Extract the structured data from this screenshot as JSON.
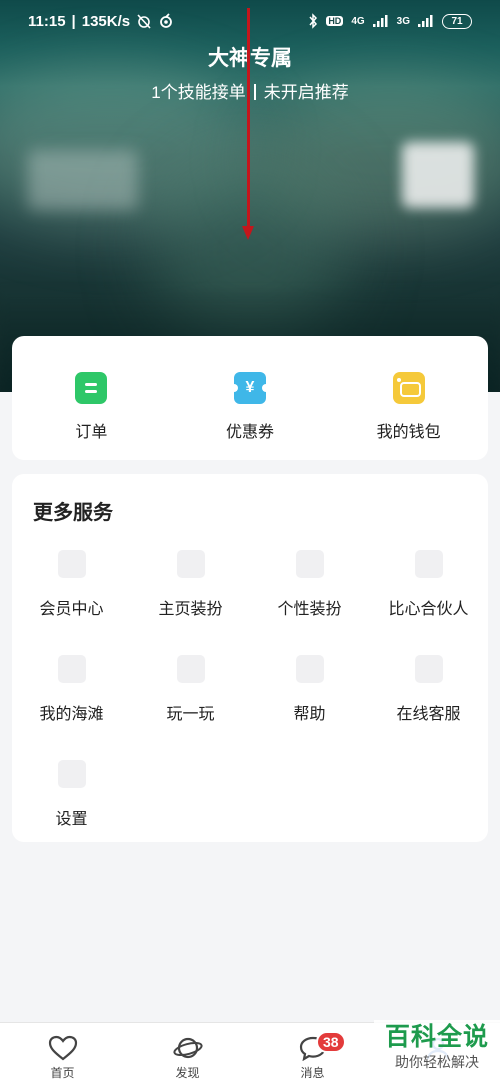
{
  "status_bar": {
    "time": "11:15",
    "speed": "135K/s",
    "signal1": "4G",
    "signal2": "3G",
    "hd": "HD",
    "battery": "71"
  },
  "header": {
    "title": "大神专属",
    "subtitle_left": "1个技能接单",
    "subtitle_right": "未开启推荐"
  },
  "quick_actions": [
    {
      "label": "订单",
      "icon": "order-icon"
    },
    {
      "label": "优惠券",
      "icon": "coupon-icon",
      "glyph": "¥"
    },
    {
      "label": "我的钱包",
      "icon": "wallet-icon"
    }
  ],
  "services": {
    "title": "更多服务",
    "items": [
      {
        "label": "会员中心"
      },
      {
        "label": "主页装扮"
      },
      {
        "label": "个性装扮"
      },
      {
        "label": "比心合伙人"
      },
      {
        "label": "我的海滩"
      },
      {
        "label": "玩一玩"
      },
      {
        "label": "帮助"
      },
      {
        "label": "在线客服"
      },
      {
        "label": "设置"
      }
    ]
  },
  "bottom_nav": {
    "items": [
      {
        "label": "首页",
        "icon": "heart-icon"
      },
      {
        "label": "发现",
        "icon": "planet-icon"
      },
      {
        "label": "消息",
        "icon": "chat-bubble-icon",
        "badge": "38"
      },
      {
        "label": "",
        "icon": "profile-icon"
      }
    ]
  },
  "watermark": {
    "title": "百科全说",
    "subtitle": "助你轻松解决"
  },
  "colors": {
    "arrow": "#c4161c",
    "order": "#2ec768",
    "coupon": "#3fb7e8",
    "wallet": "#f5c93a",
    "badge": "#e33b3b",
    "watermark": "#1e9b4d"
  }
}
